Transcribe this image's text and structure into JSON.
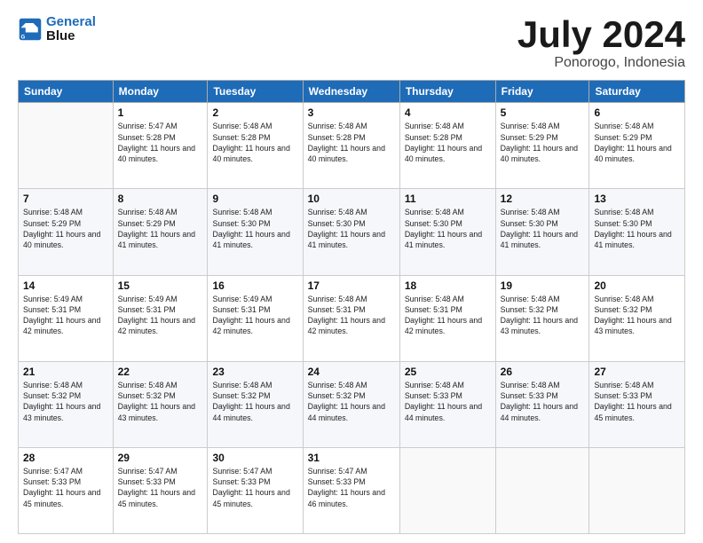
{
  "logo": {
    "line1": "General",
    "line2": "Blue"
  },
  "title": {
    "month_year": "July 2024",
    "location": "Ponorogo, Indonesia"
  },
  "header_days": [
    "Sunday",
    "Monday",
    "Tuesday",
    "Wednesday",
    "Thursday",
    "Friday",
    "Saturday"
  ],
  "weeks": [
    [
      {
        "day": "",
        "sunrise": "",
        "sunset": "",
        "daylight": ""
      },
      {
        "day": "1",
        "sunrise": "Sunrise: 5:47 AM",
        "sunset": "Sunset: 5:28 PM",
        "daylight": "Daylight: 11 hours and 40 minutes."
      },
      {
        "day": "2",
        "sunrise": "Sunrise: 5:48 AM",
        "sunset": "Sunset: 5:28 PM",
        "daylight": "Daylight: 11 hours and 40 minutes."
      },
      {
        "day": "3",
        "sunrise": "Sunrise: 5:48 AM",
        "sunset": "Sunset: 5:28 PM",
        "daylight": "Daylight: 11 hours and 40 minutes."
      },
      {
        "day": "4",
        "sunrise": "Sunrise: 5:48 AM",
        "sunset": "Sunset: 5:28 PM",
        "daylight": "Daylight: 11 hours and 40 minutes."
      },
      {
        "day": "5",
        "sunrise": "Sunrise: 5:48 AM",
        "sunset": "Sunset: 5:29 PM",
        "daylight": "Daylight: 11 hours and 40 minutes."
      },
      {
        "day": "6",
        "sunrise": "Sunrise: 5:48 AM",
        "sunset": "Sunset: 5:29 PM",
        "daylight": "Daylight: 11 hours and 40 minutes."
      }
    ],
    [
      {
        "day": "7",
        "sunrise": "Sunrise: 5:48 AM",
        "sunset": "Sunset: 5:29 PM",
        "daylight": "Daylight: 11 hours and 40 minutes."
      },
      {
        "day": "8",
        "sunrise": "Sunrise: 5:48 AM",
        "sunset": "Sunset: 5:29 PM",
        "daylight": "Daylight: 11 hours and 41 minutes."
      },
      {
        "day": "9",
        "sunrise": "Sunrise: 5:48 AM",
        "sunset": "Sunset: 5:30 PM",
        "daylight": "Daylight: 11 hours and 41 minutes."
      },
      {
        "day": "10",
        "sunrise": "Sunrise: 5:48 AM",
        "sunset": "Sunset: 5:30 PM",
        "daylight": "Daylight: 11 hours and 41 minutes."
      },
      {
        "day": "11",
        "sunrise": "Sunrise: 5:48 AM",
        "sunset": "Sunset: 5:30 PM",
        "daylight": "Daylight: 11 hours and 41 minutes."
      },
      {
        "day": "12",
        "sunrise": "Sunrise: 5:48 AM",
        "sunset": "Sunset: 5:30 PM",
        "daylight": "Daylight: 11 hours and 41 minutes."
      },
      {
        "day": "13",
        "sunrise": "Sunrise: 5:48 AM",
        "sunset": "Sunset: 5:30 PM",
        "daylight": "Daylight: 11 hours and 41 minutes."
      }
    ],
    [
      {
        "day": "14",
        "sunrise": "Sunrise: 5:49 AM",
        "sunset": "Sunset: 5:31 PM",
        "daylight": "Daylight: 11 hours and 42 minutes."
      },
      {
        "day": "15",
        "sunrise": "Sunrise: 5:49 AM",
        "sunset": "Sunset: 5:31 PM",
        "daylight": "Daylight: 11 hours and 42 minutes."
      },
      {
        "day": "16",
        "sunrise": "Sunrise: 5:49 AM",
        "sunset": "Sunset: 5:31 PM",
        "daylight": "Daylight: 11 hours and 42 minutes."
      },
      {
        "day": "17",
        "sunrise": "Sunrise: 5:48 AM",
        "sunset": "Sunset: 5:31 PM",
        "daylight": "Daylight: 11 hours and 42 minutes."
      },
      {
        "day": "18",
        "sunrise": "Sunrise: 5:48 AM",
        "sunset": "Sunset: 5:31 PM",
        "daylight": "Daylight: 11 hours and 42 minutes."
      },
      {
        "day": "19",
        "sunrise": "Sunrise: 5:48 AM",
        "sunset": "Sunset: 5:32 PM",
        "daylight": "Daylight: 11 hours and 43 minutes."
      },
      {
        "day": "20",
        "sunrise": "Sunrise: 5:48 AM",
        "sunset": "Sunset: 5:32 PM",
        "daylight": "Daylight: 11 hours and 43 minutes."
      }
    ],
    [
      {
        "day": "21",
        "sunrise": "Sunrise: 5:48 AM",
        "sunset": "Sunset: 5:32 PM",
        "daylight": "Daylight: 11 hours and 43 minutes."
      },
      {
        "day": "22",
        "sunrise": "Sunrise: 5:48 AM",
        "sunset": "Sunset: 5:32 PM",
        "daylight": "Daylight: 11 hours and 43 minutes."
      },
      {
        "day": "23",
        "sunrise": "Sunrise: 5:48 AM",
        "sunset": "Sunset: 5:32 PM",
        "daylight": "Daylight: 11 hours and 44 minutes."
      },
      {
        "day": "24",
        "sunrise": "Sunrise: 5:48 AM",
        "sunset": "Sunset: 5:32 PM",
        "daylight": "Daylight: 11 hours and 44 minutes."
      },
      {
        "day": "25",
        "sunrise": "Sunrise: 5:48 AM",
        "sunset": "Sunset: 5:33 PM",
        "daylight": "Daylight: 11 hours and 44 minutes."
      },
      {
        "day": "26",
        "sunrise": "Sunrise: 5:48 AM",
        "sunset": "Sunset: 5:33 PM",
        "daylight": "Daylight: 11 hours and 44 minutes."
      },
      {
        "day": "27",
        "sunrise": "Sunrise: 5:48 AM",
        "sunset": "Sunset: 5:33 PM",
        "daylight": "Daylight: 11 hours and 45 minutes."
      }
    ],
    [
      {
        "day": "28",
        "sunrise": "Sunrise: 5:47 AM",
        "sunset": "Sunset: 5:33 PM",
        "daylight": "Daylight: 11 hours and 45 minutes."
      },
      {
        "day": "29",
        "sunrise": "Sunrise: 5:47 AM",
        "sunset": "Sunset: 5:33 PM",
        "daylight": "Daylight: 11 hours and 45 minutes."
      },
      {
        "day": "30",
        "sunrise": "Sunrise: 5:47 AM",
        "sunset": "Sunset: 5:33 PM",
        "daylight": "Daylight: 11 hours and 45 minutes."
      },
      {
        "day": "31",
        "sunrise": "Sunrise: 5:47 AM",
        "sunset": "Sunset: 5:33 PM",
        "daylight": "Daylight: 11 hours and 46 minutes."
      },
      {
        "day": "",
        "sunrise": "",
        "sunset": "",
        "daylight": ""
      },
      {
        "day": "",
        "sunrise": "",
        "sunset": "",
        "daylight": ""
      },
      {
        "day": "",
        "sunrise": "",
        "sunset": "",
        "daylight": ""
      }
    ]
  ]
}
